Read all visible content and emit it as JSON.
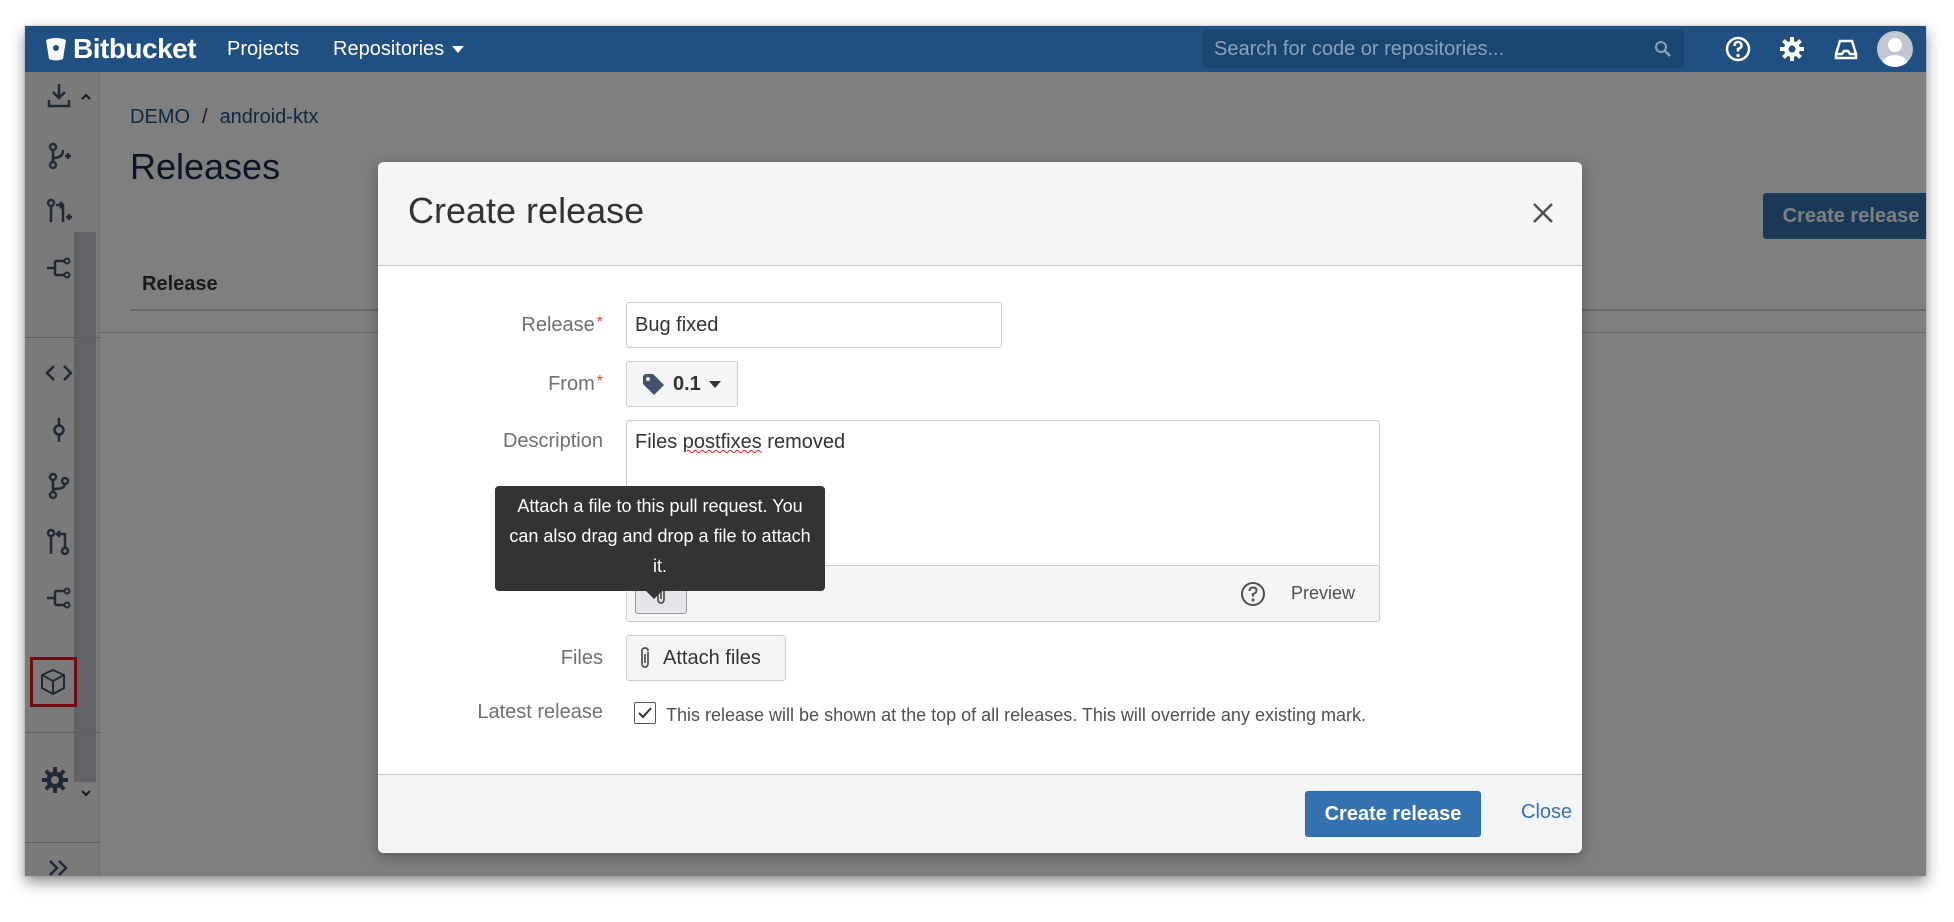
{
  "header": {
    "brand": "Bitbucket",
    "nav": {
      "projects": "Projects",
      "repositories": "Repositories"
    },
    "search_placeholder": "Search for code or repositories..."
  },
  "page": {
    "breadcrumb": {
      "project": "DEMO",
      "separator": "/",
      "repo": "android-ktx"
    },
    "title": "Releases",
    "create_button": "Create release",
    "table_header": "Release"
  },
  "dialog": {
    "title": "Create release",
    "fields": {
      "release_label": "Release",
      "release_value": "Bug fixed",
      "from_label": "From",
      "from_value": "0.1",
      "description_label": "Description",
      "description_value_a": "Files ",
      "description_value_b": "postfixes",
      "description_value_c": " removed",
      "preview_label": "Preview",
      "files_label": "Files",
      "attach_files_button": "Attach files",
      "latest_label": "Latest release",
      "latest_checked": true,
      "latest_desc": "This release will be shown at the top of all releases. This will override any existing mark."
    },
    "tooltip": "Attach a file to this pull request. You can also drag and drop a file to attach it.",
    "submit_button": "Create release",
    "close_link": "Close",
    "required_mark": "*"
  },
  "colors": {
    "header_bg": "#205081",
    "primary_button": "#3572b0",
    "highlight": "#e0191b",
    "required": "#d04437"
  }
}
